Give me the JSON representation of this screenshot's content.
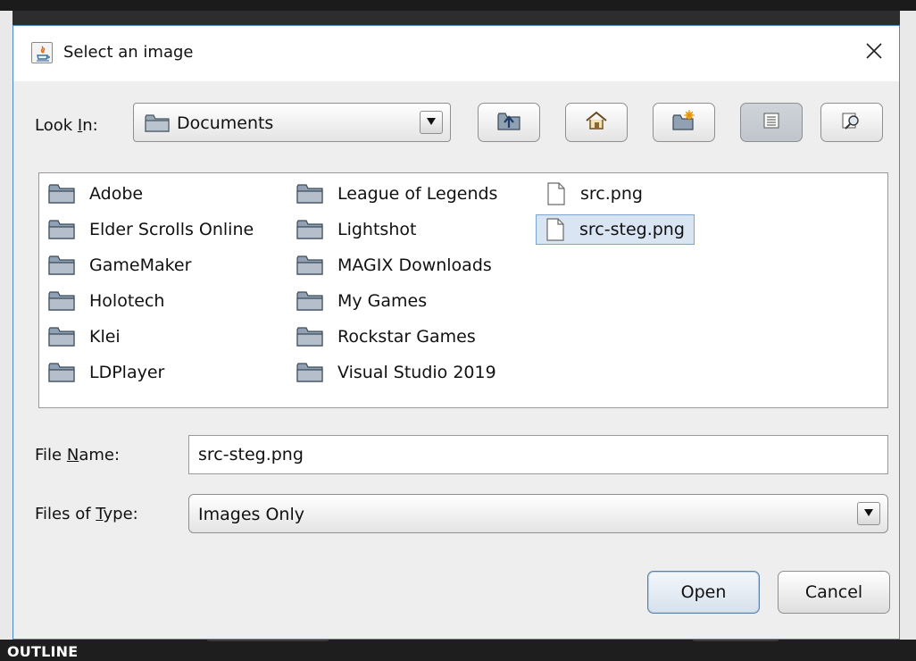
{
  "background": {
    "panel_label": "OUTLINE"
  },
  "dialog": {
    "title": "Select an image",
    "close_glyph": "✕",
    "look_in": {
      "label_prefix": "Look ",
      "label_mnemonic": "I",
      "label_suffix": "n:",
      "selected": "Documents"
    },
    "toolbar_icons": [
      "up-one-level-icon",
      "home-icon",
      "new-folder-icon",
      "list-view-icon",
      "details-view-icon"
    ],
    "files": {
      "column1": [
        "Adobe",
        "Elder Scrolls Online",
        "GameMaker",
        "Holotech",
        "Klei",
        "LDPlayer"
      ],
      "column2": [
        "League of Legends",
        "Lightshot",
        "MAGIX Downloads",
        "My Games",
        "Rockstar Games",
        "Visual Studio 2019"
      ],
      "column3": [
        "src.png",
        "src-steg.png"
      ],
      "selected": "src-steg.png"
    },
    "file_name": {
      "label_prefix": "File ",
      "label_mnemonic": "N",
      "label_suffix": "ame:",
      "value": "src-steg.png"
    },
    "files_of_type": {
      "label_prefix": "Files of ",
      "label_mnemonic": "T",
      "label_suffix": "ype:",
      "selected": "Images Only"
    },
    "buttons": {
      "open": "Open",
      "cancel": "Cancel"
    }
  },
  "colors": {
    "dialog_border": "#4f86c6",
    "selection_bg": "#dae5f3",
    "selection_border": "#7aa3d6"
  }
}
